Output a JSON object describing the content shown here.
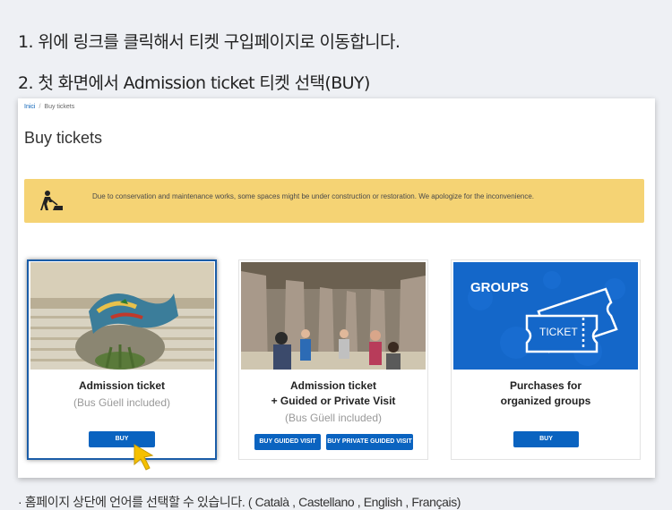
{
  "instructions": {
    "step1": "1. 위에 링크를 클릭해서 티켓 구입페이지로 이동합니다.",
    "step2": "2. 첫 화면에서 Admission ticket 티켓 선택(BUY)"
  },
  "breadcrumb": {
    "home": "Inici",
    "separator": "/",
    "current": "Buy tickets"
  },
  "page_title": "Buy tickets",
  "notice": {
    "icon": "construction-worker-icon",
    "text": "Due to conservation and maintenance works, some spaces might be under construction or restoration. We apologize for the inconvenience."
  },
  "cards": [
    {
      "title": "Admission ticket",
      "subtitle": "(Bus Güell included)",
      "button": "BUY"
    },
    {
      "title_line1": "Admission ticket",
      "title_line2": "+ Guided or Private Visit",
      "subtitle": "(Bus Güell included)",
      "button1": "BUY GUIDED VISIT",
      "button2": "BUY PRIVATE GUIDED VISIT"
    },
    {
      "banner_title": "GROUPS",
      "ticket_label": "TICKET",
      "title_line1": "Purchases for",
      "title_line2": "organized groups",
      "button": "BUY"
    }
  ],
  "footnote": "· 홈페이지 상단에 언어를 선택할 수 있습니다. ( Català , Castellano , English , Français)",
  "colors": {
    "accent": "#0a63c0",
    "notice_bg": "#f5d374",
    "groups_bg": "#1467c9",
    "cursor": "#f5c000"
  }
}
